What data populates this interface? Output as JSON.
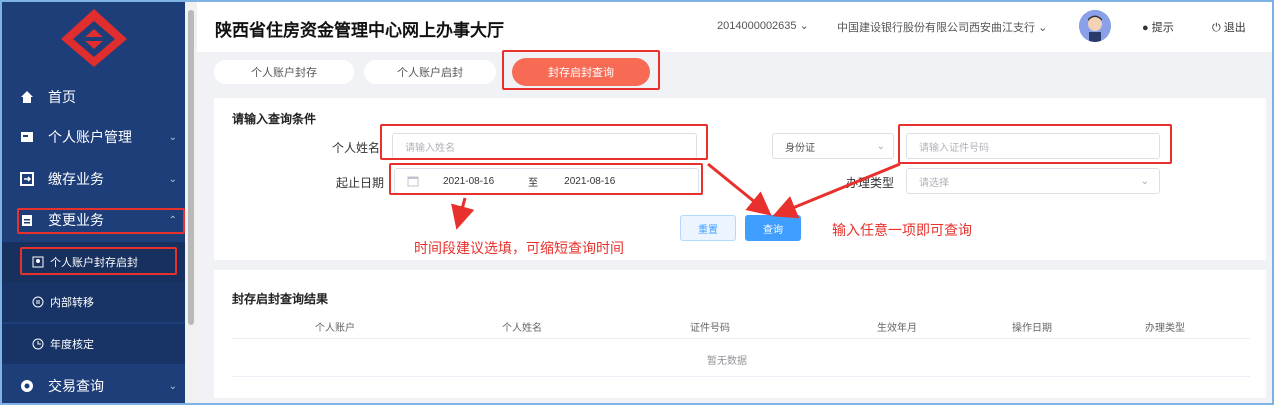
{
  "app": {
    "title": "陕西省住房资金管理中心网上办事大厅"
  },
  "header": {
    "account_no": "2014000002635",
    "bank": "中国建设银行股份有限公司西安曲江支行",
    "notice": "提示",
    "logout": "退出"
  },
  "sidebar": {
    "items": [
      {
        "label": "首页"
      },
      {
        "label": "个人账户管理"
      },
      {
        "label": "缴存业务"
      },
      {
        "label": "变更业务"
      },
      {
        "label": "交易查询"
      }
    ],
    "sub_items": [
      {
        "label": "个人账户封存启封"
      },
      {
        "label": "内部转移"
      },
      {
        "label": "年度核定"
      }
    ]
  },
  "tabs": [
    {
      "label": "个人账户封存"
    },
    {
      "label": "个人账户启封"
    },
    {
      "label": "封存启封查询"
    }
  ],
  "query": {
    "section_title": "请输入查询条件",
    "name_label": "个人姓名",
    "name_placeholder": "请输入姓名",
    "id_type": "身份证",
    "id_placeholder": "请输入证件号码",
    "date_label": "起止日期",
    "date_start": "2021-08-16",
    "date_sep": "至",
    "date_end": "2021-08-16",
    "type_label": "办理类型",
    "type_placeholder": "请选择",
    "reset": "重置",
    "search": "查询"
  },
  "annotations": {
    "date_tip": "时间段建议选填，可缩短查询时间",
    "any_tip": "输入任意一项即可查询"
  },
  "results": {
    "title": "封存启封查询结果",
    "columns": [
      "个人账户",
      "个人姓名",
      "证件号码",
      "生效年月",
      "操作日期",
      "办理类型"
    ],
    "empty": "暂无数据"
  },
  "colors": {
    "sidebar": "#1e3e7a",
    "accent": "#f76b55",
    "primary": "#409eff",
    "annotation": "#e8302c"
  }
}
